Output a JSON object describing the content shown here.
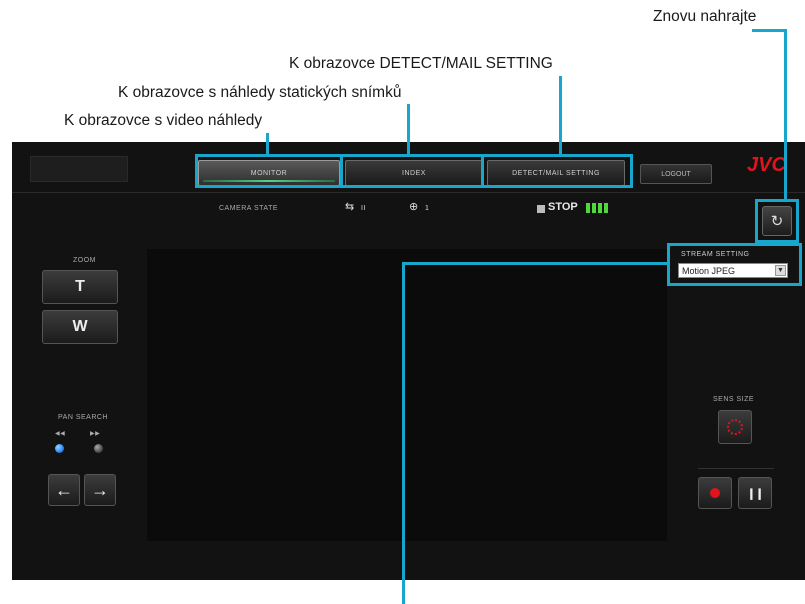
{
  "annotations": {
    "reload": "Znovu nahrajte",
    "detect_mail": "K obrazovce DETECT/MAIL SETTING",
    "index_screen": "K obrazovce s náhledy statických snímků",
    "monitor_screen": "K obrazovce s video náhledy"
  },
  "app": {
    "logo": "JVC",
    "tabs": [
      {
        "label": "MONITOR"
      },
      {
        "label": "INDEX"
      },
      {
        "label": "DETECT/MAIL SETTING"
      }
    ],
    "top_right_label": "LOGOUT",
    "status": {
      "camera_state": "CAMERA STATE",
      "pan_value": "II",
      "zoom_value": "1",
      "stop_label": "STOP"
    },
    "zoom": {
      "title": "ZOOM",
      "tele": "T",
      "wide": "W"
    },
    "pan_search": {
      "title": "PAN SEARCH",
      "left_label": "◀◀",
      "right_label": "▶▶"
    },
    "streaming": {
      "title": "STREAM SETTING",
      "selected": "Motion JPEG"
    },
    "recording": {
      "title": "SENS SIZE"
    },
    "colors": {
      "accent": "#18a6cc",
      "logo_red": "#e0141c",
      "led_blue": "#2f8fff",
      "rec_red": "#e0141c"
    }
  }
}
